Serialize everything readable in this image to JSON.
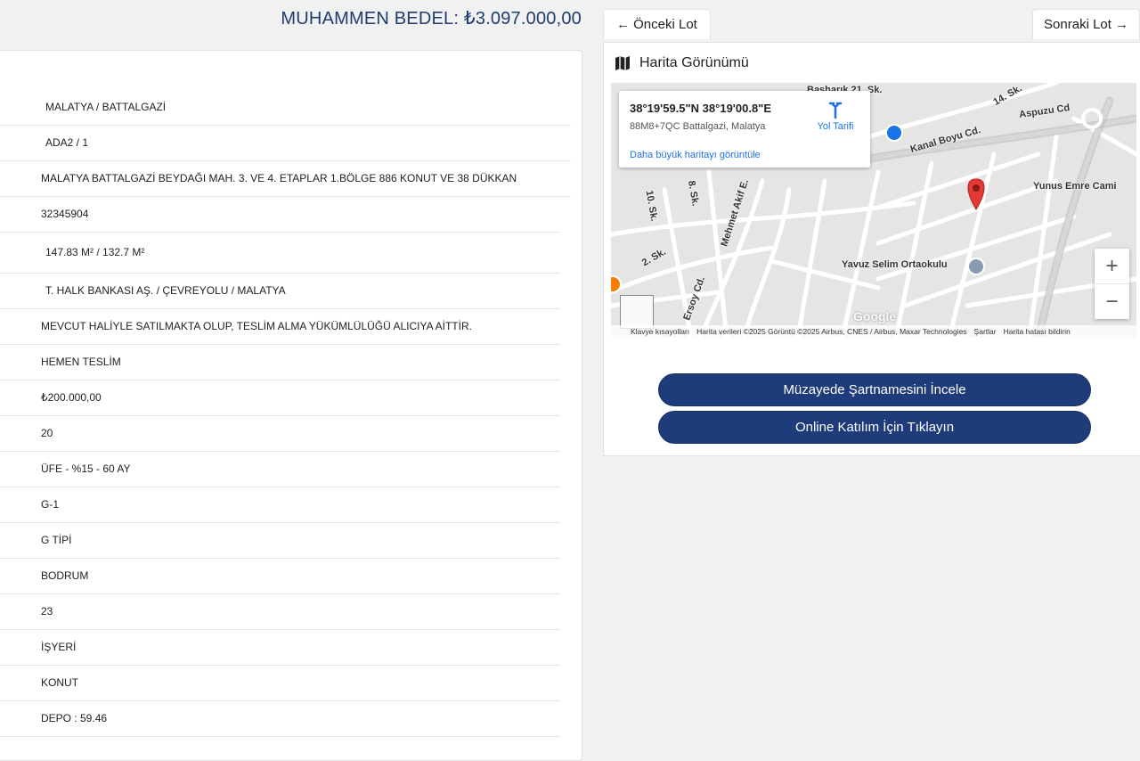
{
  "header": {
    "price_label": "MUHAMMEN BEDEL:",
    "price_value": "₺3.097.000,00",
    "accent_color": "#1f3c72"
  },
  "details": {
    "rows": [
      "MALATYA / BATTALGAZİ",
      "ADA2 / 1",
      "MALATYA BATTALGAZİ BEYDAĞI MAH. 3. VE 4. ETAPLAR 1.BÖLGE 886 KONUT VE 38 DÜKKAN",
      "32345904",
      "147.83 M² / 132.7 M²",
      "T. HALK BANKASI AŞ. / ÇEVREYOLU / MALATYA",
      "MEVCUT HALİYLE SATILMAKTA OLUP, TESLİM ALMA YÜKÜMLÜLÜĞÜ ALICIYA AİTTİR.",
      "HEMEN TESLİM",
      "₺200.000,00",
      "20",
      "ÜFE - %15 - 60 AY",
      "G-1",
      "G TİPİ",
      "BODRUM",
      "23",
      "İŞYERİ",
      "KONUT",
      "DEPO : 59.46"
    ]
  },
  "nav": {
    "prev_label": "Önceki Lot",
    "next_label": "Sonraki Lot"
  },
  "map": {
    "title": "Harita Görünümü",
    "info": {
      "coordinates": "38°19'59.5\"N 38°19'00.8\"E",
      "plus_code": "88M8+7QC Battalgazi, Malatya",
      "bigger_map_link": "Daha büyük haritayı görüntüle",
      "directions_label": "Yol Tarifi"
    },
    "places": {
      "mosque": "Yunus Emre Cami",
      "school": "Yavuz Selim Ortaokulu",
      "street_kanal": "Kanal Boyu Cd.",
      "street_aspuzu": "Aspuzu Cd",
      "street_mehmet_akif": "Mehmet Akif E.",
      "street_ersoy": "Ersoy Cd.",
      "street_21": "Başharık 21. Sk.",
      "street_10sk": "10. Sk.",
      "street_8sk": "8. Sk.",
      "street_2sk": "2. Sk.",
      "street_14sk": "14. Sk."
    },
    "zoom_in_label": "+",
    "zoom_out_label": "−",
    "google_logo": "Google",
    "attribution": {
      "shortcuts": "Klavye kısayolları",
      "data": "Harita verileri ©2025 Görüntü ©2025 Airbus, CNES / Airbus, Maxar Technologies",
      "terms": "Şartlar",
      "report": "Harita hatası bildirin"
    }
  },
  "actions": {
    "spec_label": "Müzayede Şartnamesini İncele",
    "online_label": "Online Katılım İçin Tıklayın",
    "button_color": "#1f3c7a"
  }
}
